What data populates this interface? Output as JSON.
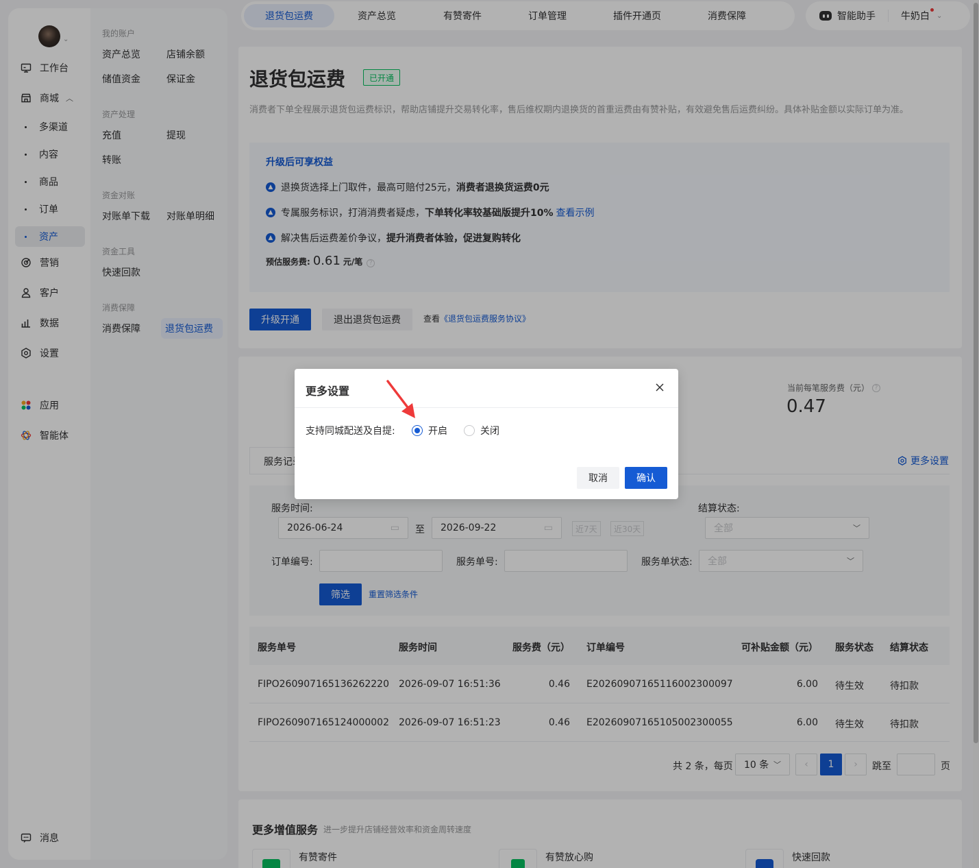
{
  "sidebar": {
    "items": [
      {
        "label": "工作台",
        "icon": "workbench-icon"
      },
      {
        "label": "商城",
        "icon": "store-icon"
      },
      {
        "label": "营销",
        "icon": "marketing-icon"
      },
      {
        "label": "客户",
        "icon": "customer-icon"
      },
      {
        "label": "数据",
        "icon": "data-icon"
      },
      {
        "label": "设置",
        "icon": "settings-icon"
      },
      {
        "label": "应用",
        "icon": "apps-icon"
      },
      {
        "label": "智能体",
        "icon": "agent-icon"
      }
    ],
    "store_children": [
      "多渠道",
      "内容",
      "商品",
      "订单",
      "资产"
    ],
    "message": "消息"
  },
  "subnav": {
    "groups": [
      {
        "title": "我的账户",
        "links": [
          "资产总览",
          "店铺余额",
          "储值资金",
          "保证金"
        ]
      },
      {
        "title": "资产处理",
        "links": [
          "充值",
          "提现",
          "转账"
        ]
      },
      {
        "title": "资金对账",
        "links": [
          "对账单下载",
          "对账单明细"
        ]
      },
      {
        "title": "资金工具",
        "links": [
          "快速回款"
        ]
      },
      {
        "title": "消费保障",
        "links": [
          "消费保障",
          "退货包运费"
        ]
      }
    ]
  },
  "topnav": {
    "tabs": [
      "退货包运费",
      "资产总览",
      "有赞寄件",
      "订单管理",
      "插件开通页",
      "消费保障"
    ],
    "assistant": "智能助手",
    "user": "牛奶白"
  },
  "hero": {
    "title": "退货包运费",
    "badge": "已开通",
    "description": "消费者下单全程展示退货包运费标识，帮助店铺提升交易转化率，售后维权期内退换货的首重运费由有赞补贴，有效避免售后运费纠纷。具体补贴金额以实际订单为准。",
    "benefits_title": "升级后可享权益",
    "benefits": [
      {
        "text": "退换货选择上门取件，最高可赔付25元，",
        "bold": "消费者退换货运费0元",
        "link": ""
      },
      {
        "text": "专属服务标识，打消消费者疑虑，",
        "bold": "下单转化率较基础版提升10%",
        "link": "查看示例"
      },
      {
        "text": "解决售后运费差价争议，",
        "bold": "提升消费者体验，促进复购转化",
        "link": ""
      }
    ],
    "fee_label": "预估服务费:",
    "fee_value": "0.61",
    "fee_unit": "元/笔",
    "btn_upgrade": "升级开通",
    "btn_exit": "退出退货包运费",
    "agreement_prefix": "查看",
    "agreement_link": "《退货包运费服务协议》"
  },
  "stats": {
    "current_fee_label": "当前每笔服务费（元）",
    "current_fee_value": "0.47"
  },
  "records": {
    "tab_label": "服务记录",
    "more_settings": "更多设置",
    "filter": {
      "service_time_label": "服务时间:",
      "date_from": "2026-06-24",
      "date_to": "2026-09-22",
      "to": "至",
      "quick7": "近7天",
      "quick30": "近30天",
      "settle_status_label": "结算状态:",
      "settle_status_value": "全部",
      "order_no_label": "订单编号:",
      "service_no_label": "服务单号:",
      "service_status_label": "服务单状态:",
      "service_status_value": "全部",
      "filter_btn": "筛选",
      "reset": "重置筛选条件"
    },
    "columns": [
      "服务单号",
      "服务时间",
      "服务费（元）",
      "订单编号",
      "可补贴金额（元）",
      "服务状态",
      "结算状态"
    ],
    "rows": [
      [
        "FIPO260907165136262220",
        "2026-09-07 16:51:36",
        "0.46",
        "E20260907165116002300097",
        "6.00",
        "待生效",
        "待扣款"
      ],
      [
        "FIPO260907165124000002",
        "2026-09-07 16:51:23",
        "0.46",
        "E20260907165105002300055",
        "6.00",
        "待生效",
        "待扣款"
      ]
    ],
    "pagination": {
      "total_text": "共 2 条，每页",
      "page_size": "10 条",
      "current_page": "1",
      "jump_label": "跳至",
      "page_suffix": "页"
    }
  },
  "more_services": {
    "title": "更多增值服务",
    "subtitle": "进一步提升店铺经营效率和资金周转速度",
    "items": [
      "有赞寄件",
      "有赞放心购",
      "快速回款"
    ]
  },
  "dialog": {
    "title": "更多设置",
    "field_label": "支持同城配送及自提:",
    "option_on": "开启",
    "option_off": "关闭",
    "selected": "开启",
    "cancel": "取消",
    "confirm": "确认"
  },
  "colors": {
    "primary": "#155bd4",
    "success": "#07c160",
    "annotation_arrow": "#ee3a3a"
  }
}
